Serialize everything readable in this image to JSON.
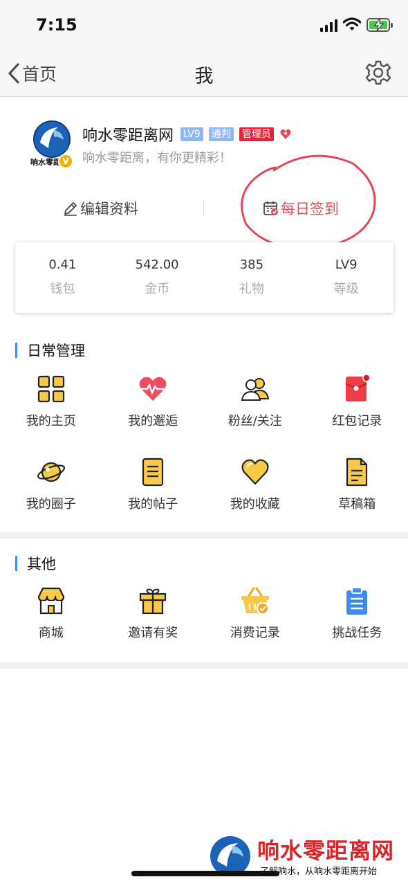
{
  "status_bar": {
    "time": "7:15"
  },
  "nav": {
    "back_label": "首页",
    "title": "我"
  },
  "profile": {
    "avatar_text": "响水零距离",
    "verify_mark": "V",
    "username": "响水零距离网",
    "tags": {
      "level": "LV9",
      "judge": "通判",
      "admin": "管理员"
    },
    "signature": "响水零距离，有你更精彩！"
  },
  "actions": {
    "edit": "编辑资料",
    "checkin": "每日签到"
  },
  "stats": [
    {
      "value": "0.41",
      "label": "钱包"
    },
    {
      "value": "542.00",
      "label": "金币"
    },
    {
      "value": "385",
      "label": "礼物"
    },
    {
      "value": "LV9",
      "label": "等级"
    }
  ],
  "daily": {
    "title": "日常管理",
    "items": [
      {
        "label": "我的主页",
        "icon": "grid-icon"
      },
      {
        "label": "我的邂逅",
        "icon": "heartbeat-icon"
      },
      {
        "label": "粉丝/关注",
        "icon": "people-icon"
      },
      {
        "label": "红包记录",
        "icon": "red-envelope-icon"
      },
      {
        "label": "我的圈子",
        "icon": "planet-icon"
      },
      {
        "label": "我的帖子",
        "icon": "document-icon"
      },
      {
        "label": "我的收藏",
        "icon": "heart-icon"
      },
      {
        "label": "草稿箱",
        "icon": "draft-icon"
      }
    ]
  },
  "other": {
    "title": "其他",
    "items": [
      {
        "label": "商城",
        "icon": "shop-icon"
      },
      {
        "label": "邀请有奖",
        "icon": "gift-icon"
      },
      {
        "label": "消费记录",
        "icon": "basket-icon"
      },
      {
        "label": "挑战任务",
        "icon": "clipboard-icon"
      }
    ]
  },
  "watermark": {
    "title": "响水零距离网",
    "subtitle": "了解响水，从响水零距离开始"
  },
  "colors": {
    "accent_blue": "#3b8ef0",
    "admin_red": "#e8243a",
    "checkin_red": "#e34c5a",
    "icon_yellow": "#f7c948"
  }
}
